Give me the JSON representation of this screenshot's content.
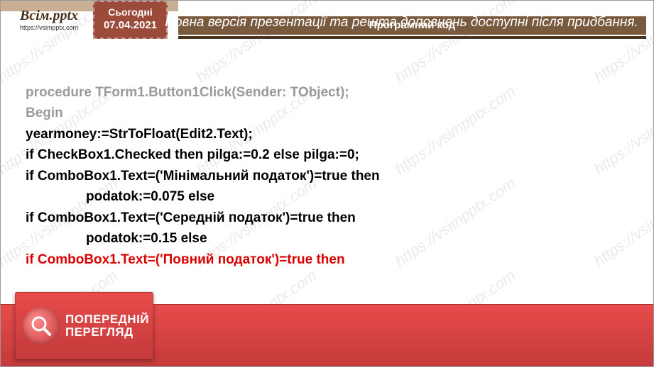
{
  "logo": {
    "main": "Всім.pptx",
    "sub": "https://vsimpptx.com"
  },
  "date": {
    "label": "Сьогодні",
    "value": "07.04.2021"
  },
  "title": "Програмний код",
  "watermark": "https://vsimpptx.com",
  "code": {
    "l1": "procedure TForm1.Button1Click(Sender: TObject);",
    "l2": "Begin",
    "l3": "yearmoney:=StrToFloat(Edit2.Text);",
    "l4": "if CheckBox1.Checked then pilga:=0.2 else pilga:=0;",
    "l5": "if ComboBox1.Text=('Мінімальний податок')=true then",
    "l6": "podatok:=0.075 else",
    "l7": "if ComboBox1.Text=('Середній податок')=true then",
    "l8": "podatok:=0.15 else",
    "l9": "if ComboBox1.Text=('Повний податок')=true then"
  },
  "badge": {
    "line1": "ПОПЕРЕДНІЙ",
    "line2": "ПЕРЕГЛЯД"
  },
  "footer": "Повна версія презентації та решта доповнень доступні після придбання."
}
